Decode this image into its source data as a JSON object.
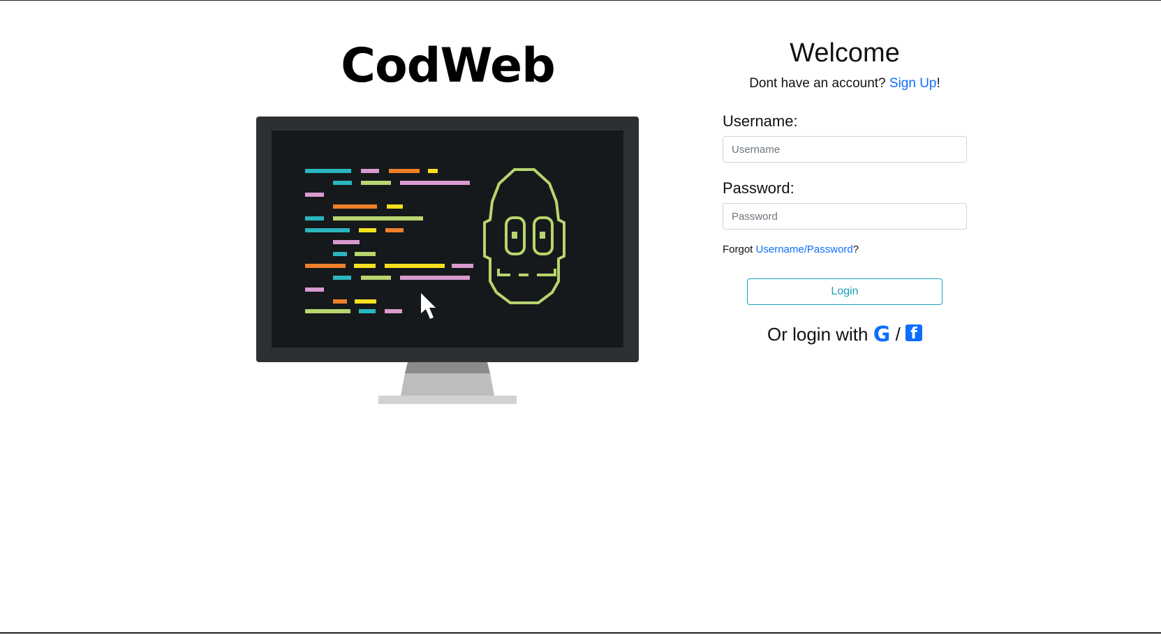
{
  "brand": {
    "title": "CodWeb"
  },
  "login": {
    "welcome": "Welcome",
    "signup_prompt": "Dont have an account? ",
    "signup_link": "Sign Up",
    "signup_suffix": "!",
    "username_label": "Username:",
    "username_placeholder": "Username",
    "username_value": "",
    "password_label": "Password:",
    "password_placeholder": "Password",
    "password_value": "",
    "forgot_prefix": "Forgot ",
    "forgot_link": "Username/Password",
    "forgot_suffix": "?",
    "login_button": "Login",
    "social_prefix": "Or login with ",
    "social_separator": " / ",
    "google_icon": "google-icon",
    "facebook_icon": "facebook-icon"
  },
  "colors": {
    "link": "#0d6efd",
    "login_button": "#17a2b8",
    "screen": "#16191b",
    "bezel": "#2d3033",
    "robot": "#b8d56f"
  }
}
